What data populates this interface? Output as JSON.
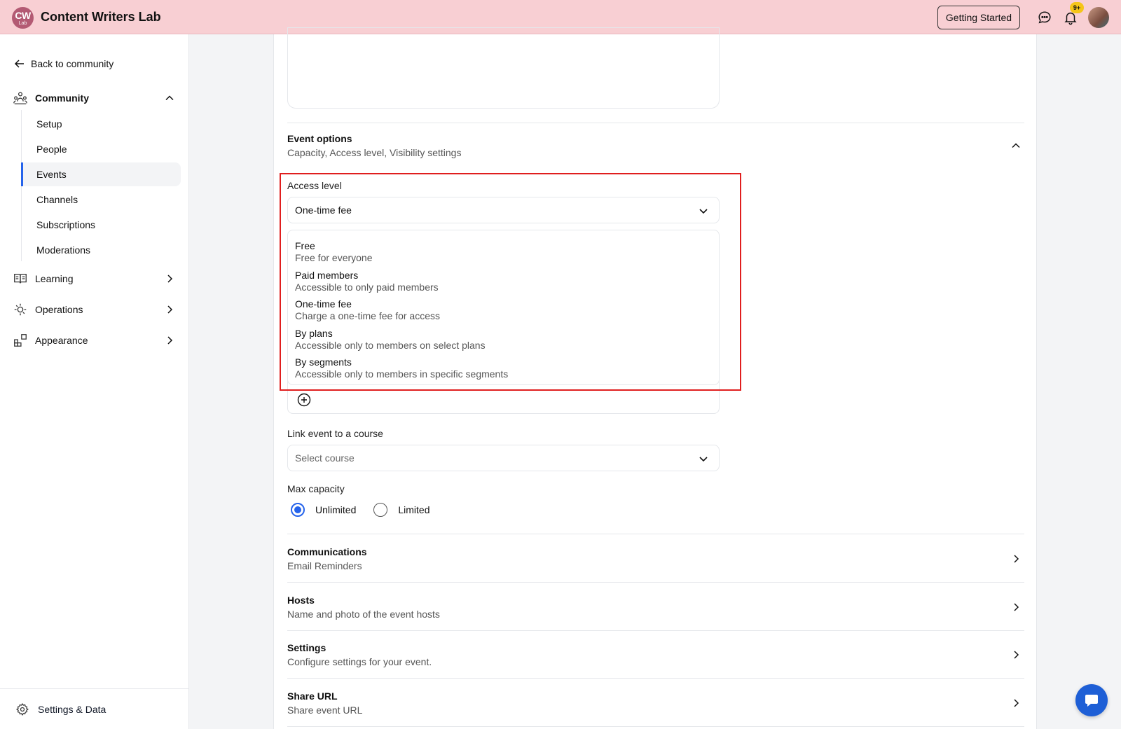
{
  "header": {
    "logo_line1": "CW",
    "logo_line2": "Lab",
    "brand": "Content Writers Lab",
    "getting_started": "Getting Started",
    "notification_badge": "9+"
  },
  "sidebar": {
    "back": "Back to community",
    "community": "Community",
    "sub_items": [
      "Setup",
      "People",
      "Events",
      "Channels",
      "Subscriptions",
      "Moderations"
    ],
    "active_item": "Events",
    "learning": "Learning",
    "operations": "Operations",
    "appearance": "Appearance",
    "settings_data": "Settings & Data"
  },
  "main": {
    "event_options": {
      "title": "Event options",
      "subtitle": "Capacity, Access level, Visibility settings"
    },
    "access_level": {
      "label": "Access level",
      "selected": "One-time fee",
      "options": [
        {
          "title": "Free",
          "desc": "Free for everyone"
        },
        {
          "title": "Paid members",
          "desc": "Accessible to only paid members"
        },
        {
          "title": "One-time fee",
          "desc": "Charge a one-time fee for access"
        },
        {
          "title": "By plans",
          "desc": "Accessible only to members on select plans"
        },
        {
          "title": "By segments",
          "desc": "Accessible only to members in specific segments"
        }
      ]
    },
    "link_course": {
      "label": "Link event to a course",
      "placeholder": "Select course"
    },
    "max_capacity": {
      "label": "Max capacity",
      "options": [
        "Unlimited",
        "Limited"
      ],
      "selected": "Unlimited"
    },
    "sections": [
      {
        "title": "Communications",
        "subtitle": "Email Reminders"
      },
      {
        "title": "Hosts",
        "subtitle": "Name and photo of the event hosts"
      },
      {
        "title": "Settings",
        "subtitle": "Configure settings for your event."
      },
      {
        "title": "Share URL",
        "subtitle": "Share event URL"
      }
    ]
  },
  "colors": {
    "topbar": "#f8cfd3",
    "accent": "#2563eb",
    "highlight": "#e01e1e",
    "fab": "#1e5fd6"
  }
}
